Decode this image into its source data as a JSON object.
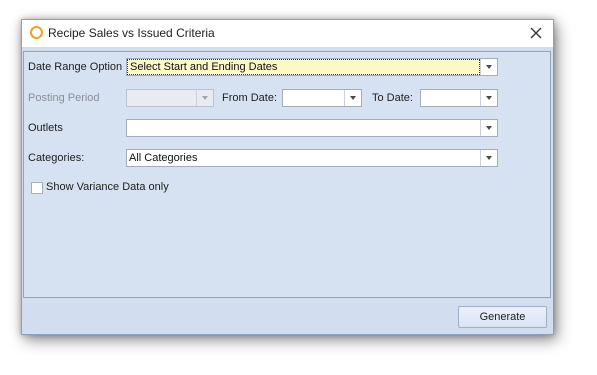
{
  "window": {
    "title": "Recipe Sales vs Issued Criteria",
    "accent_color": "#f0a22a"
  },
  "form": {
    "date_range": {
      "label": "Date Range Option",
      "value": "Select Start and Ending Dates"
    },
    "posting_period": {
      "label": "Posting Period",
      "value": ""
    },
    "from_date": {
      "label": "From Date:",
      "value": ""
    },
    "to_date": {
      "label": "To Date:",
      "value": ""
    },
    "outlets": {
      "label": "Outlets",
      "value": ""
    },
    "categories": {
      "label": "Categories:",
      "value": "All Categories"
    },
    "variance_checkbox": {
      "label": "Show Variance Data only",
      "checked": false
    }
  },
  "footer": {
    "generate_label": "Generate"
  }
}
